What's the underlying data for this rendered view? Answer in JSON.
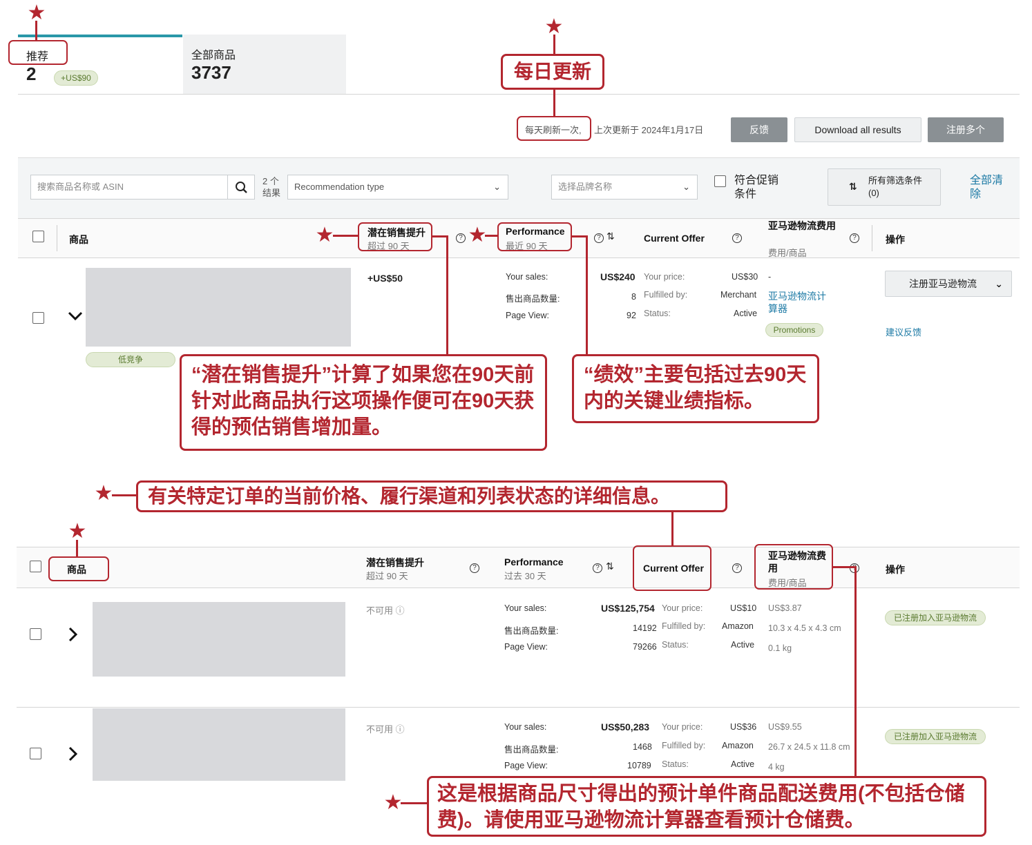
{
  "tabs": {
    "recommended": {
      "label": "推荐",
      "count": "2",
      "badge": "+US$90"
    },
    "all": {
      "label": "全部商品",
      "count": "3737"
    }
  },
  "toolbar": {
    "refresh_note": "每天刷新一次,",
    "updated": "上次更新于 2024年1月17日",
    "feedback_label": "反馈",
    "download_label": "Download all results",
    "register_many_label": "注册多个"
  },
  "filters": {
    "search_placeholder": "搜索商品名称或 ASIN",
    "result_count": "2 个结果",
    "rec_type": "Recommendation type",
    "brand": "选择品牌名称",
    "promo_label": "符合促销条件",
    "all_filters": "所有筛选条件 (0)",
    "clear_all": "全部清除"
  },
  "columns": {
    "product": "商品",
    "potential": "潜在销售提升",
    "potential_sub_top": "超过 90 天",
    "potential_sub_bottom": "超过 90 天",
    "performance": "Performance",
    "performance_sub_top": "最近 90 天",
    "performance_sub_bottom": "过去 30 天",
    "offer": "Current Offer",
    "fba_fee": "亚马逊物流费用",
    "fba_fee_sub": "费用/商品",
    "actions": "操作"
  },
  "top_row": {
    "uplift": "+US$50",
    "competition": "低竞争",
    "your_sales_label": "Your sales:",
    "your_sales": "US$240",
    "units_label": "售出商品数量:",
    "units": "8",
    "page_view_label": "Page View:",
    "page_view": "92",
    "price_label": "Your price:",
    "price": "US$30",
    "fulfilled_label": "Fulfilled by:",
    "fulfilled": "Merchant",
    "status_label": "Status:",
    "status": "Active",
    "fee": "-",
    "calc_link": "亚马逊物流计算器",
    "promotions": "Promotions",
    "register_label": "注册亚马逊物流",
    "feedback_link": "建议反馈"
  },
  "bottom_rows": [
    {
      "uplift": "不可用",
      "your_sales_label": "Your sales:",
      "your_sales": "US$125,754",
      "units_label": "售出商品数量:",
      "units": "14192",
      "page_view_label": "Page View:",
      "page_view": "79266",
      "price_label": "Your price:",
      "price": "US$10",
      "fulfilled_label": "Fulfilled by:",
      "fulfilled": "Amazon",
      "status_label": "Status:",
      "status": "Active",
      "fee": "US$3.87",
      "dims": "10.3 x 4.5 x 4.3 cm",
      "weight": "0.1 kg",
      "action": "已注册加入亚马逊物流"
    },
    {
      "uplift": "不可用",
      "your_sales_label": "Your sales:",
      "your_sales": "US$50,283",
      "units_label": "售出商品数量:",
      "units": "1468",
      "page_view_label": "Page View:",
      "page_view": "10789",
      "price_label": "Your price:",
      "price": "US$36",
      "fulfilled_label": "Fulfilled by:",
      "fulfilled": "Amazon",
      "status_label": "Status:",
      "status": "Active",
      "fee": "US$9.55",
      "dims": "26.7 x 24.5 x 11.8 cm",
      "weight": "4 kg",
      "action": "已注册加入亚马逊物流"
    }
  ],
  "callouts": {
    "daily": "每日更新",
    "potential": "“潜在销售提升”计算了如果您在90天前针对此商品执行这项操作便可在90天获得的预估销售增加量。",
    "performance": "“绩效”主要包括过去90天内的关键业绩指标。",
    "offer": "有关特定订单的当前价格、履行渠道和列表状态的详细信息。",
    "fee": "这是根据商品尺寸得出的预计单件商品配送费用(不包括仓储费)。请使用亚马逊物流计算器查看预计仓储费。"
  },
  "colors": {
    "annotation_red": "#b3262f",
    "link_blue": "#1d7aa5",
    "button_gray": "#8a9094"
  }
}
